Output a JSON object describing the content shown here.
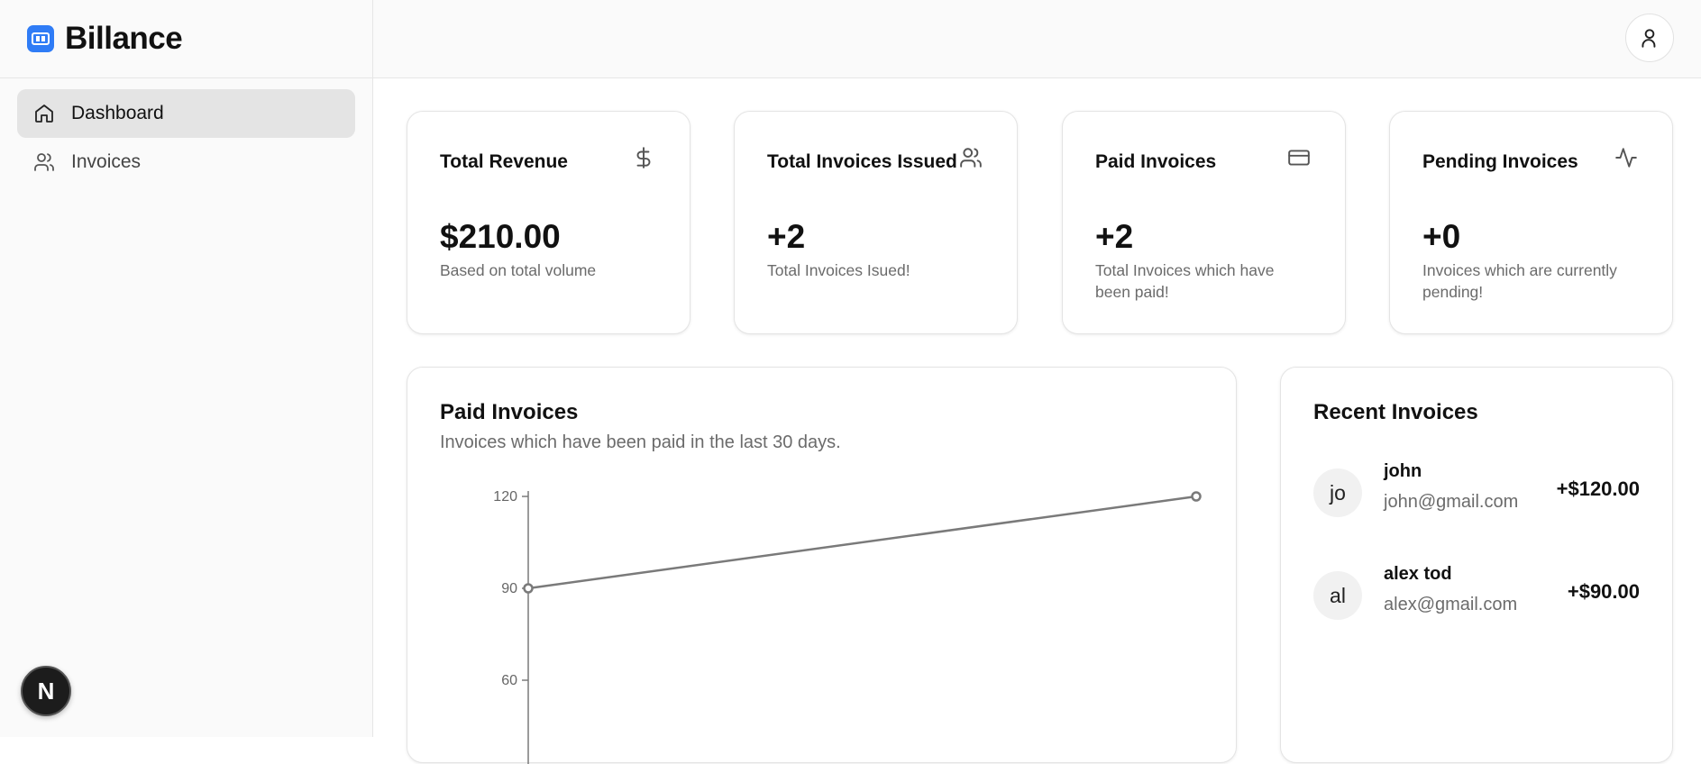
{
  "app": {
    "name": "Billance"
  },
  "sidebar": {
    "items": [
      {
        "label": "Dashboard",
        "icon": "home-icon",
        "active": true
      },
      {
        "label": "Invoices",
        "icon": "users-icon",
        "active": false
      }
    ],
    "badge": "N"
  },
  "header": {
    "user_icon": "user-icon"
  },
  "stats": [
    {
      "title": "Total Revenue",
      "value": "$210.00",
      "description": "Based on total volume",
      "icon": "dollar-icon"
    },
    {
      "title": "Total Invoices Issued",
      "value": "+2",
      "description": "Total Invoices Isued!",
      "icon": "users-icon"
    },
    {
      "title": "Paid Invoices",
      "value": "+2",
      "description": "Total Invoices which have been paid!",
      "icon": "credit-card-icon"
    },
    {
      "title": "Pending Invoices",
      "value": "+0",
      "description": "Invoices which are currently pending!",
      "icon": "activity-icon"
    }
  ],
  "paid_section": {
    "title": "Paid Invoices",
    "subtitle": "Invoices which have been paid in the last 30 days."
  },
  "chart_data": {
    "type": "line",
    "x": [
      1,
      2
    ],
    "series": [
      {
        "values": [
          90,
          120
        ]
      }
    ],
    "yticks": [
      60,
      90,
      120
    ],
    "ylim": [
      60,
      120
    ],
    "grid": false,
    "line_color": "#7a7a7a"
  },
  "recent": {
    "title": "Recent Invoices",
    "items": [
      {
        "initials": "jo",
        "name": "john",
        "email": "john@gmail.com",
        "amount": "+$120.00"
      },
      {
        "initials": "al",
        "name": "alex tod",
        "email": "alex@gmail.com",
        "amount": "+$90.00"
      }
    ]
  }
}
